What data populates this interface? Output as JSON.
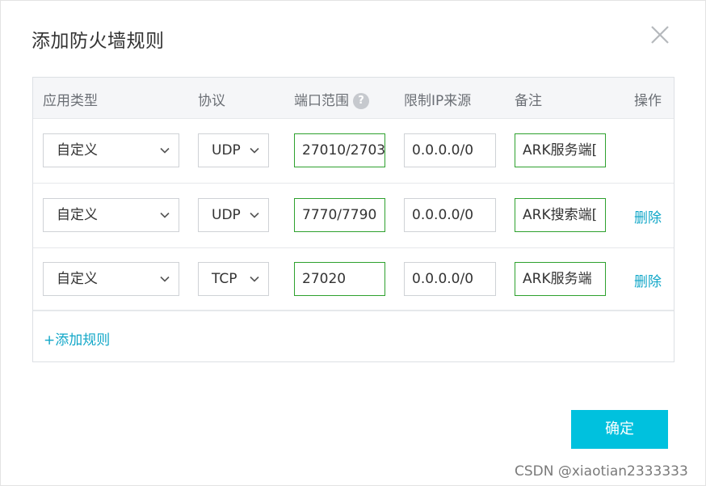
{
  "dialog": {
    "title": "添加防火墙规则",
    "close_icon": "close-icon"
  },
  "table": {
    "headers": {
      "app_type": "应用类型",
      "protocol": "协议",
      "port_range": "端口范围",
      "source_ip": "限制IP来源",
      "note": "备注",
      "action": "操作"
    },
    "help_glyph": "?",
    "rows": [
      {
        "app_type": "自定义",
        "protocol": "UDP",
        "port": "27010/2703",
        "source": "0.0.0.0/0",
        "note": "ARK服务端[",
        "delete_label": ""
      },
      {
        "app_type": "自定义",
        "protocol": "UDP",
        "port": "7770/7790",
        "source": "0.0.0.0/0",
        "note": "ARK搜索端[",
        "delete_label": "删除"
      },
      {
        "app_type": "自定义",
        "protocol": "TCP",
        "port": "27020",
        "source": "0.0.0.0/0",
        "note": "ARK服务端",
        "delete_label": "删除"
      }
    ],
    "add_rule_label": "+添加规则"
  },
  "footer": {
    "confirm_label": "确定"
  },
  "watermark": "CSDN @xiaotian2333333",
  "colors": {
    "accent": "#00c1de",
    "link": "#12a7c8",
    "valid_border": "#2ea12e",
    "header_bg": "#f5f6f8"
  }
}
